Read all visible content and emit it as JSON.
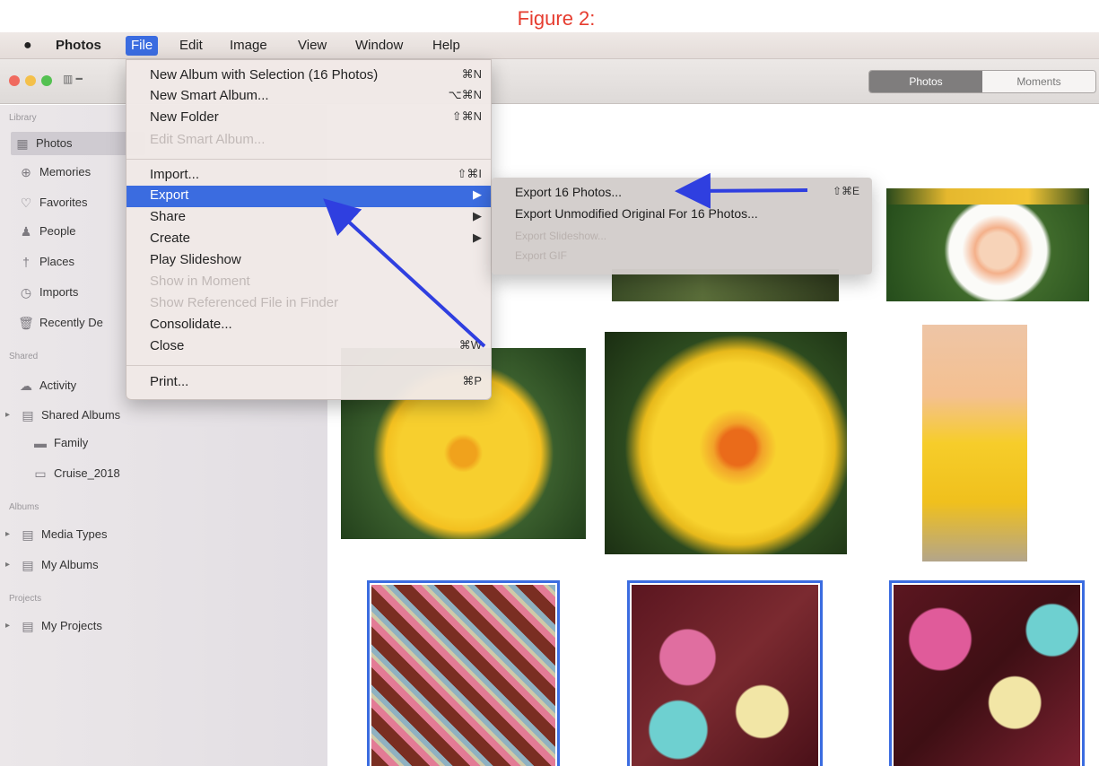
{
  "figure_title": "Figure 2:",
  "menubar": {
    "apple_icon": "apple-icon",
    "app_name": "Photos",
    "items": [
      "File",
      "Edit",
      "Image",
      "View",
      "Window",
      "Help"
    ]
  },
  "toolbar": {
    "segments": [
      "Photos",
      "Moments"
    ]
  },
  "sidebar": {
    "section_library": "Library",
    "library": [
      {
        "label": "Photos",
        "icon": "photos-grid-icon",
        "selected": true
      },
      {
        "label": "Memories",
        "icon": "memories-icon"
      },
      {
        "label": "Favorites",
        "icon": "heart-icon"
      },
      {
        "label": "People",
        "icon": "person-icon"
      },
      {
        "label": "Places",
        "icon": "pin-icon"
      },
      {
        "label": "Imports",
        "icon": "clock-icon"
      },
      {
        "label": "Recently De",
        "icon": "trash-icon"
      }
    ],
    "section_shared": "Shared",
    "shared": [
      {
        "label": "Activity",
        "icon": "cloud-icon"
      },
      {
        "label": "Shared Albums",
        "icon": "folder-icon"
      },
      {
        "label": "Family",
        "icon": "album-icon"
      },
      {
        "label": "Cruise_2018",
        "icon": "album-icon"
      }
    ],
    "section_albums": "Albums",
    "albums": [
      {
        "label": "Media Types",
        "icon": "folder-icon"
      },
      {
        "label": "My Albums",
        "icon": "folder-icon"
      }
    ],
    "section_projects": "Projects",
    "projects": [
      {
        "label": "My Projects",
        "icon": "folder-icon"
      }
    ]
  },
  "file_menu": {
    "items": [
      {
        "label": "New Album with Selection (16 Photos)",
        "shortcut": "⌘N"
      },
      {
        "label": "New Smart Album...",
        "shortcut": "⌥⌘N"
      },
      {
        "label": "New Folder",
        "shortcut": "⇧⌘N"
      },
      {
        "label": "Edit Smart Album...",
        "shortcut": "",
        "disabled": true
      },
      {
        "label": "Import...",
        "shortcut": "⇧⌘I"
      },
      {
        "label": "Export",
        "shortcut": "▶",
        "highlighted": true
      },
      {
        "label": "Share",
        "shortcut": "▶"
      },
      {
        "label": "Create",
        "shortcut": "▶"
      },
      {
        "label": "Play Slideshow",
        "shortcut": ""
      },
      {
        "label": "Show in Moment",
        "shortcut": "",
        "disabled": true
      },
      {
        "label": "Show Referenced File in Finder",
        "shortcut": "",
        "disabled": true
      },
      {
        "label": "Consolidate...",
        "shortcut": ""
      },
      {
        "label": "Close",
        "shortcut": "⌘W"
      },
      {
        "label": "Print...",
        "shortcut": "⌘P"
      }
    ]
  },
  "export_submenu": {
    "items": [
      {
        "label": "Export 16 Photos...",
        "shortcut": "⇧⌘E"
      },
      {
        "label": "Export Unmodified Original For 16 Photos...",
        "shortcut": ""
      },
      {
        "label": "Export Slideshow...",
        "shortcut": "",
        "disabled": true
      },
      {
        "label": "Export GIF",
        "shortcut": "",
        "disabled": true
      }
    ]
  },
  "colors": {
    "accent": "#3b6ce0",
    "figure_title": "#e63c2f",
    "annotation_arrow": "#2f3fe0"
  }
}
